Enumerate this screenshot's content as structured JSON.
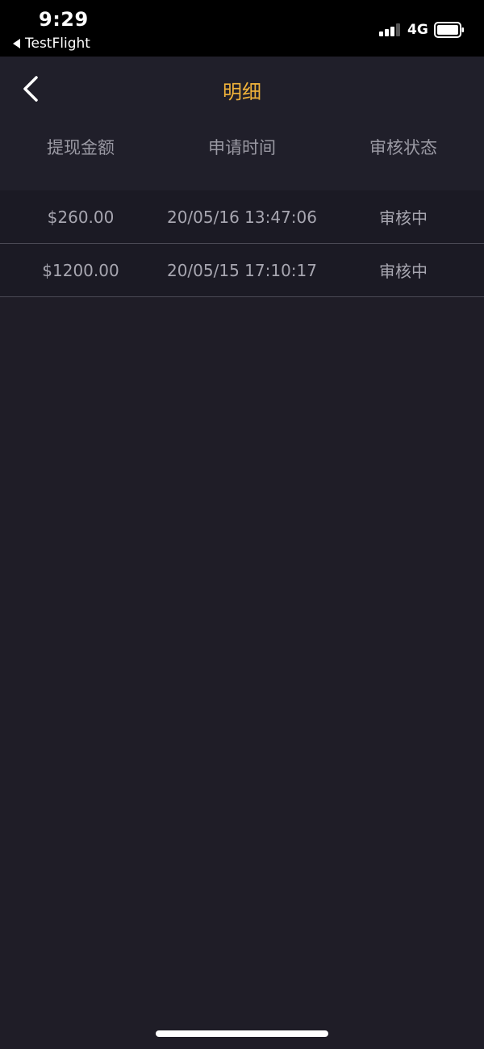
{
  "status_bar": {
    "time": "9:29",
    "back_app_label": "TestFlight",
    "network": "4G"
  },
  "nav": {
    "title": "明细"
  },
  "table": {
    "headers": [
      "提现金额",
      "申请时间",
      "审核状态"
    ],
    "rows": [
      {
        "amount": "$260.00",
        "time": "20/05/16 13:47:06",
        "status": "审核中"
      },
      {
        "amount": "$1200.00",
        "time": "20/05/15 17:10:17",
        "status": "审核中"
      }
    ]
  },
  "colors": {
    "title": "#f0b23a",
    "background": "#1f1d27",
    "status_bar": "#000000"
  }
}
